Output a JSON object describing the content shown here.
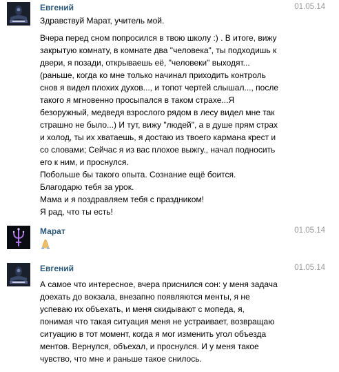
{
  "messages": [
    {
      "author": "Евгений",
      "date": "01.05.14",
      "avatar": "dark-emblem-avatar",
      "lines": [
        "Здравствуй Марат, учитель мой.",
        "Вчера перед сном попросился в твою школу :) . В итоге, вижу",
        "закрытую комнату, в комнате два \"человека\", ты подходишь к",
        "двери, я позади, открываешь её, \"человеки\" выходят...",
        "(раньше, когда ко мне только начинал приходить контроль",
        "снов я видел плохих духов..., и топот чертей слышал..., после",
        "такого я мгновенно просыпался в таком страхе...Я",
        "безоружный, медведя взрослого рядом в лесу видел мне так",
        "страшно не было...) И тут, вижу \"людей\", а в душе прям страх",
        "и холод, ты их хватаешь, я достаю из твоего кармана крест и",
        "со словами; Сейчас я из вас плохое выжгу., начал подносить",
        "его к ним, и проснулся.",
        "Побольше бы такого опыта. Сознание ещё боится.",
        "Благодарю тебя за урок.",
        "Мама и я поздравляем тебя с праздником!",
        "Я рад, что ты есть!"
      ]
    },
    {
      "author": "Марат",
      "date": "01.05.14",
      "avatar": "trident-symbol-avatar",
      "emoji": "praying-hands-emoji"
    },
    {
      "author": "Евгений",
      "date": "01.05.14",
      "avatar": "dark-emblem-avatar",
      "lines": [
        "А самое что интересное, вчера приснился сон: у меня задача",
        "доехать до вокзала, внезапно появляются менты, я не",
        "успеваю их объехать, и меня скидывают с мопеда, я,",
        "понимая что такая ситуация меня не устраивает, возвращаю",
        "ситуацию в тот момент, когда я мог изменить угол объезда",
        "ментов. Вернулся, объехал, и проснулся. И у меня такое",
        "чувство, что мне и раньше такое снилось."
      ]
    }
  ],
  "colors": {
    "author": "#2b587a",
    "date": "#999999",
    "text": "#000000",
    "background": "#ffffff"
  }
}
